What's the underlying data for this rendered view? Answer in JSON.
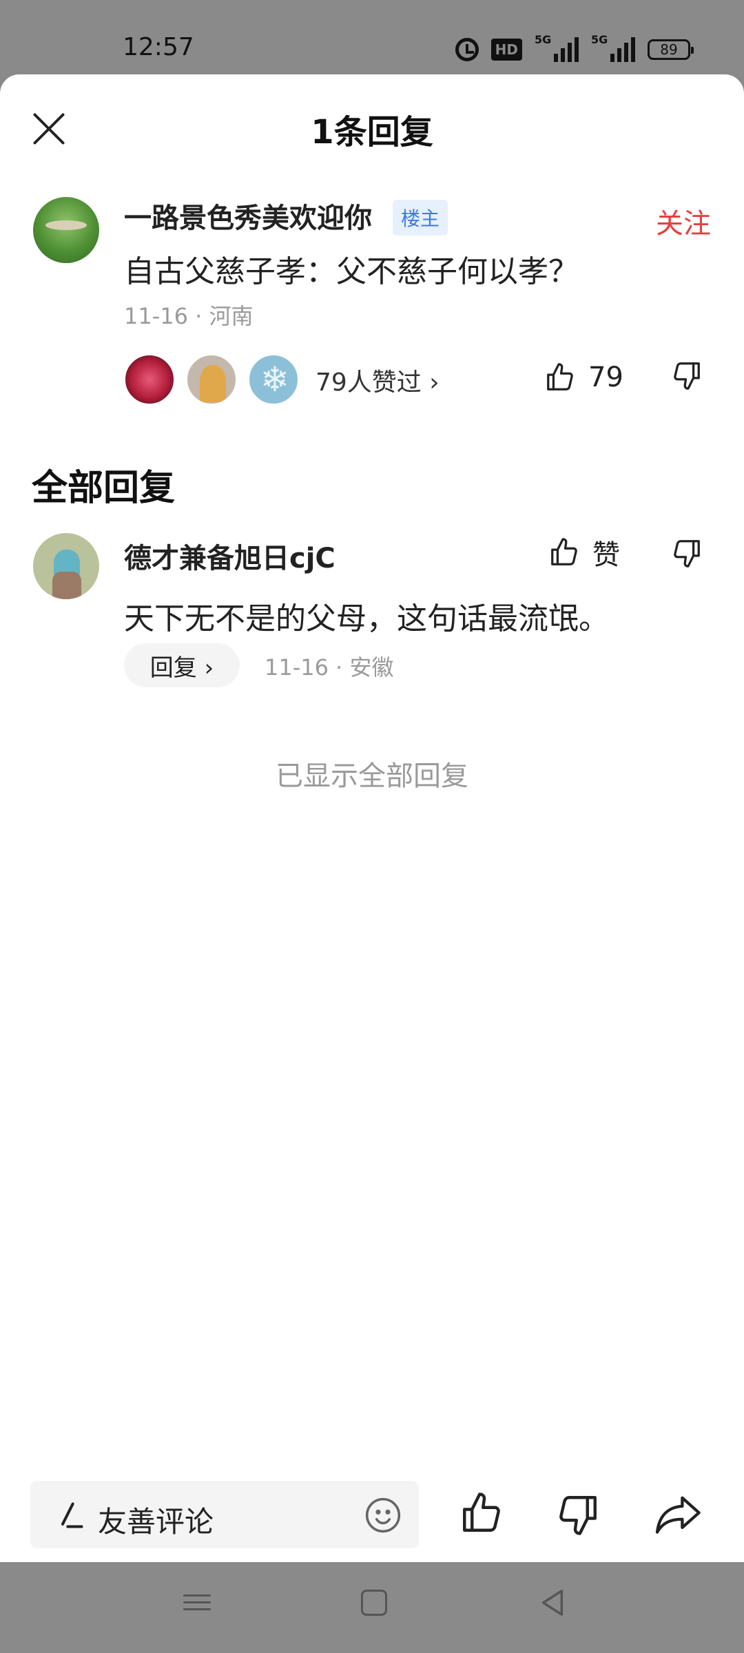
{
  "status_bar": {
    "time": "12:57",
    "hd_label": "HD",
    "signal1_label": "5G",
    "signal2_label": "5G",
    "battery": "89",
    "icons": [
      "alarm-icon",
      "hd-icon",
      "signal-icon",
      "signal-icon",
      "battery-icon"
    ]
  },
  "header": {
    "title": "1条回复",
    "close_icon": "close-icon"
  },
  "main_comment": {
    "username": "一路景色秀美欢迎你",
    "badge": "楼主",
    "follow_label": "关注",
    "text": "自古父慈子孝：父不慈子何以孝？",
    "meta": "11-16 · 河南",
    "likers_label": "79人赞过 ›",
    "like_count": "79"
  },
  "section": {
    "title": "全部回复"
  },
  "reply": {
    "username": "德才兼备旭日cjC",
    "like_label": "赞",
    "text": "天下无不是的父母，这句话最流氓。",
    "reply_button": "回复 ›",
    "meta": "11-16 · 安徽"
  },
  "footer_note": "已显示全部回复",
  "bottom_bar": {
    "input_placeholder": "友善评论",
    "icons": [
      "pen-icon",
      "emoji-icon",
      "thumbs-up-icon",
      "thumbs-down-icon",
      "share-icon"
    ]
  },
  "colors": {
    "accent_red": "#e5403f",
    "badge_blue": "#3d7ae3",
    "muted_gray": "#9a9a9a"
  }
}
